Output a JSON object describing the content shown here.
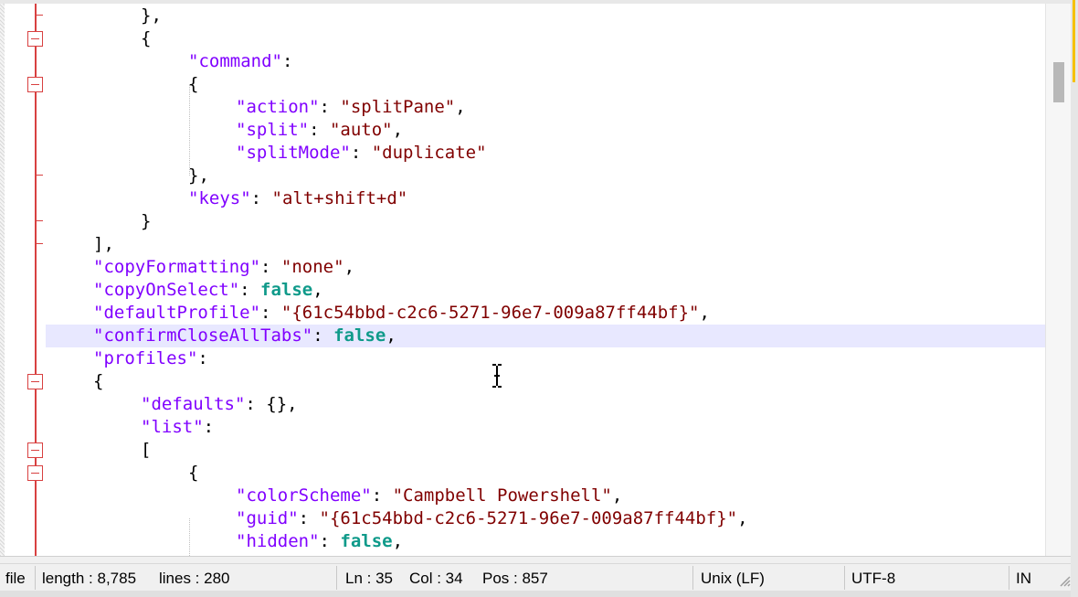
{
  "editor": {
    "lines": [
      {
        "indent": 2,
        "tokens": [
          [
            "p",
            "},"
          ]
        ]
      },
      {
        "indent": 2,
        "tokens": [
          [
            "p",
            "{"
          ]
        ]
      },
      {
        "indent": 3,
        "tokens": [
          [
            "k",
            "\"command\""
          ],
          [
            "p",
            ":"
          ]
        ]
      },
      {
        "indent": 3,
        "tokens": [
          [
            "p",
            "{"
          ]
        ]
      },
      {
        "indent": 4,
        "tokens": [
          [
            "k",
            "\"action\""
          ],
          [
            "p",
            ": "
          ],
          [
            "s",
            "\"splitPane\""
          ],
          [
            "p",
            ","
          ]
        ]
      },
      {
        "indent": 4,
        "tokens": [
          [
            "k",
            "\"split\""
          ],
          [
            "p",
            ": "
          ],
          [
            "s",
            "\"auto\""
          ],
          [
            "p",
            ","
          ]
        ]
      },
      {
        "indent": 4,
        "tokens": [
          [
            "k",
            "\"splitMode\""
          ],
          [
            "p",
            ": "
          ],
          [
            "s",
            "\"duplicate\""
          ]
        ]
      },
      {
        "indent": 3,
        "tokens": [
          [
            "p",
            "},"
          ]
        ]
      },
      {
        "indent": 3,
        "tokens": [
          [
            "k",
            "\"keys\""
          ],
          [
            "p",
            ": "
          ],
          [
            "s",
            "\"alt+shift+d\""
          ]
        ]
      },
      {
        "indent": 2,
        "tokens": [
          [
            "p",
            "}"
          ]
        ]
      },
      {
        "indent": 1,
        "tokens": [
          [
            "p",
            "],"
          ]
        ]
      },
      {
        "indent": 1,
        "tokens": [
          [
            "k",
            "\"copyFormatting\""
          ],
          [
            "p",
            ": "
          ],
          [
            "s",
            "\"none\""
          ],
          [
            "p",
            ","
          ]
        ]
      },
      {
        "indent": 1,
        "tokens": [
          [
            "k",
            "\"copyOnSelect\""
          ],
          [
            "p",
            ": "
          ],
          [
            "b",
            "false"
          ],
          [
            "p",
            ","
          ]
        ]
      },
      {
        "indent": 1,
        "tokens": [
          [
            "k",
            "\"defaultProfile\""
          ],
          [
            "p",
            ": "
          ],
          [
            "s",
            "\"{61c54bbd-c2c6-5271-96e7-009a87ff44bf}\""
          ],
          [
            "p",
            ","
          ]
        ]
      },
      {
        "indent": 1,
        "current": true,
        "tokens": [
          [
            "k",
            "\"confirmCloseAllTabs\""
          ],
          [
            "p",
            ": "
          ],
          [
            "b",
            "false"
          ],
          [
            "p",
            ","
          ]
        ]
      },
      {
        "indent": 1,
        "tokens": [
          [
            "k",
            "\"profiles\""
          ],
          [
            "p",
            ":"
          ]
        ]
      },
      {
        "indent": 1,
        "tokens": [
          [
            "p",
            "{"
          ]
        ]
      },
      {
        "indent": 2,
        "tokens": [
          [
            "k",
            "\"defaults\""
          ],
          [
            "p",
            ": {},"
          ]
        ]
      },
      {
        "indent": 2,
        "tokens": [
          [
            "k",
            "\"list\""
          ],
          [
            "p",
            ":"
          ]
        ]
      },
      {
        "indent": 2,
        "tokens": [
          [
            "p",
            "["
          ]
        ]
      },
      {
        "indent": 3,
        "tokens": [
          [
            "p",
            "{"
          ]
        ]
      },
      {
        "indent": 4,
        "tokens": [
          [
            "k",
            "\"colorScheme\""
          ],
          [
            "p",
            ": "
          ],
          [
            "s",
            "\"Campbell Powershell\""
          ],
          [
            "p",
            ","
          ]
        ]
      },
      {
        "indent": 4,
        "tokens": [
          [
            "k",
            "\"guid\""
          ],
          [
            "p",
            ": "
          ],
          [
            "s",
            "\"{61c54bbd-c2c6-5271-96e7-009a87ff44bf}\""
          ],
          [
            "p",
            ","
          ]
        ]
      },
      {
        "indent": 4,
        "tokens": [
          [
            "k",
            "\"hidden\""
          ],
          [
            "p",
            ": "
          ],
          [
            "b",
            "false"
          ],
          [
            "p",
            ","
          ]
        ]
      }
    ]
  },
  "statusbar": {
    "type": "file",
    "length": "length : 8,785",
    "lines": "lines : 280",
    "ln": "Ln : 35",
    "col": "Col : 34",
    "pos": "Pos : 857",
    "eol": "Unix (LF)",
    "encoding": "UTF-8",
    "mode": "IN"
  },
  "colors": {
    "keyword": "#8000ff",
    "string": "#800000",
    "boolean": "#0f9a8a",
    "current_line": "#e8e8ff",
    "fold_margin": "#d84040"
  },
  "icons": [
    "fold-box-icon",
    "text-cursor-icon",
    "resize-grip-icon"
  ]
}
